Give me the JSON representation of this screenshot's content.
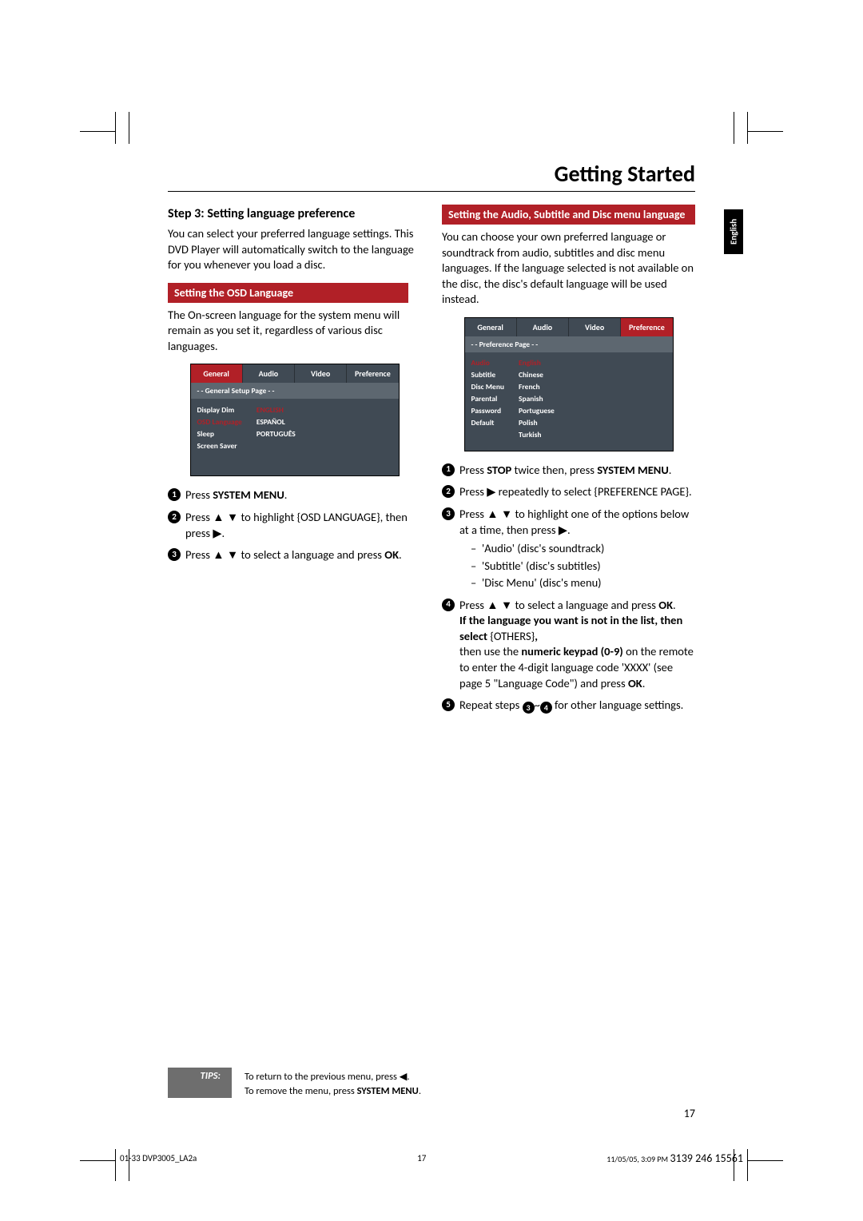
{
  "page": {
    "sectionTitle": "Getting Started",
    "sideTab": "English",
    "pageNumber": "17"
  },
  "left": {
    "stepHeading": "Step 3:  Setting language preference",
    "intro": "You can select your preferred language settings. This DVD Player will automatically switch to the language for you whenever you load a disc.",
    "redbar": "Setting the OSD Language",
    "osdIntro": "The On-screen language for the system menu will remain as you set it, regardless of various disc languages.",
    "osd": {
      "tabs": [
        "General",
        "Audio",
        "Video",
        "Preference"
      ],
      "activeTab": 0,
      "pageLabel": "- -   General Setup Page   - -",
      "leftItems": [
        {
          "label": "Display Dim",
          "sel": false
        },
        {
          "label": "OSD Language",
          "sel": true
        },
        {
          "label": "Sleep",
          "sel": false
        },
        {
          "label": "Screen Saver",
          "sel": false
        }
      ],
      "rightItems": [
        {
          "label": "ENGLISH",
          "sel": true
        },
        {
          "label": "ESPAÑOL",
          "sel": false
        },
        {
          "label": "PORTUGUÊS",
          "sel": false
        }
      ]
    },
    "steps": {
      "s1_a": "Press ",
      "s1_b": "SYSTEM MENU",
      "s1_c": ".",
      "s2": "Press ▲ ▼ to highlight {OSD LANGUAGE}, then press ▶.",
      "s3_a": "Press ▲ ▼  to select a language and press ",
      "s3_b": "OK",
      "s3_c": "."
    }
  },
  "right": {
    "redbar": "Setting the Audio, Subtitle and Disc menu language",
    "intro": "You can choose your own preferred language or soundtrack from audio, subtitles and disc menu languages. If the language selected is not available on the disc, the disc's default language will be used instead.",
    "osd": {
      "tabs": [
        "General",
        "Audio",
        "Video",
        "Preference"
      ],
      "activeTab": 3,
      "pageLabel": "- -   Preference Page   - -",
      "leftItems": [
        {
          "label": "Audio",
          "sel": true
        },
        {
          "label": "Subtitle",
          "sel": false
        },
        {
          "label": "Disc Menu",
          "sel": false
        },
        {
          "label": "Parental",
          "sel": false
        },
        {
          "label": "Password",
          "sel": false
        },
        {
          "label": "Default",
          "sel": false
        }
      ],
      "rightItems": [
        {
          "label": "English",
          "sel": true
        },
        {
          "label": "Chinese",
          "sel": false
        },
        {
          "label": "French",
          "sel": false
        },
        {
          "label": "Spanish",
          "sel": false
        },
        {
          "label": "Portuguese",
          "sel": false
        },
        {
          "label": "Polish",
          "sel": false
        },
        {
          "label": "Turkish",
          "sel": false
        }
      ]
    },
    "steps": {
      "s1_a": "Press ",
      "s1_b": "STOP",
      "s1_c": " twice then, press ",
      "s1_d": "SYSTEM MENU",
      "s1_e": ".",
      "s2": "Press ▶ repeatedly to select {PREFERENCE PAGE}.",
      "s3": "Press ▲ ▼ to highlight one of the options below at a time, then press ▶.",
      "s3_items": [
        "'Audio' (disc's soundtrack)",
        "'Subtitle' (disc's subtitles)",
        "'Disc Menu' (disc's menu)"
      ],
      "s4_a": "Press ▲ ▼ to select a language and press ",
      "s4_b": "OK",
      "s4_c": ".",
      "s4_bold1": "If the language you want is not in the list, then select ",
      "s4_others": "{OTHERS}",
      "s4_comma": ",",
      "s4_p2a": "then use the ",
      "s4_p2b": "numeric keypad (0-9)",
      "s4_p2c": " on the remote to enter the 4-digit language code 'XXXX' (see page 5 \"Language Code\") and press ",
      "s4_p2d": "OK",
      "s4_p2e": ".",
      "s5_a": "Repeat steps ",
      "s5_b": "~",
      "s5_c": " for other language settings."
    }
  },
  "tips": {
    "label": "TIPS:",
    "line1a": "To return to the previous menu, press ◀.",
    "line2a": "To remove the menu, press ",
    "line2b": "SYSTEM MENU",
    "line2c": "."
  },
  "footer": {
    "left": "01-33 DVP3005_LA2a",
    "mid": "17",
    "rightDate": "11/05/05, 3:09 PM",
    "rightCode": "3139 246 15561"
  }
}
